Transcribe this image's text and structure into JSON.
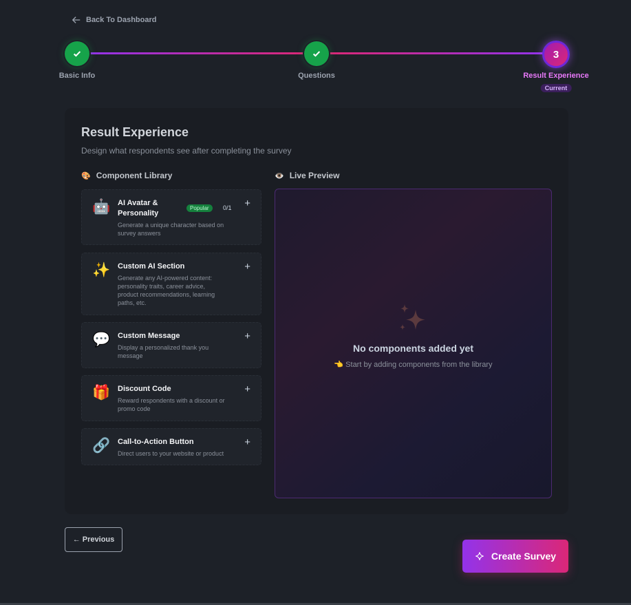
{
  "nav": {
    "back_label": "Back To Dashboard"
  },
  "stepper": {
    "steps": [
      {
        "label": "Basic Info",
        "state": "done"
      },
      {
        "label": "Questions",
        "state": "done"
      },
      {
        "label": "Result Experience",
        "state": "current",
        "number": "3"
      }
    ],
    "current_badge": "Current"
  },
  "card": {
    "title": "Result Experience",
    "subtitle": "Design what respondents see after completing the survey"
  },
  "library": {
    "heading": "Component Library",
    "heading_icon": "palette-icon",
    "components": [
      {
        "name": "AI Avatar & Personality",
        "name_line1": "AI Avatar &",
        "name_line2": "Personality",
        "badge": "Popular",
        "count": "0/1",
        "icon": "robot-icon",
        "glyph": "🤖",
        "desc_lines": [
          "Generate a unique character based on",
          "survey answers"
        ]
      },
      {
        "name": "Custom AI Section",
        "icon": "sparkles-icon",
        "glyph": "✨",
        "desc_lines": [
          "Generate any AI-powered content:",
          "personality traits, career advice,",
          "product recommendations, learning",
          "paths, etc."
        ]
      },
      {
        "name": "Custom Message",
        "icon": "speech-bubble-icon",
        "glyph": "💬",
        "desc_lines": [
          "Display a personalized thank you",
          "message"
        ]
      },
      {
        "name": "Discount Code",
        "icon": "gift-icon",
        "glyph": "🎁",
        "desc_lines": [
          "Reward respondents with a discount or",
          "promo code"
        ]
      },
      {
        "name": "Call-to-Action Button",
        "icon": "link-icon",
        "glyph": "🔗",
        "desc_lines": [
          "Direct users to your website or product"
        ]
      }
    ]
  },
  "preview": {
    "heading": "Live Preview",
    "heading_icon": "eye-icon",
    "empty_title": "No components added yet",
    "empty_sub": "👈 Start by adding components from the library"
  },
  "footer": {
    "previous_label": "← Previous",
    "create_label": "Create Survey"
  },
  "colors": {
    "accent_purple": "#9333ea",
    "accent_pink": "#db2777",
    "success_green": "#16a34a",
    "background": "#1d2128"
  }
}
